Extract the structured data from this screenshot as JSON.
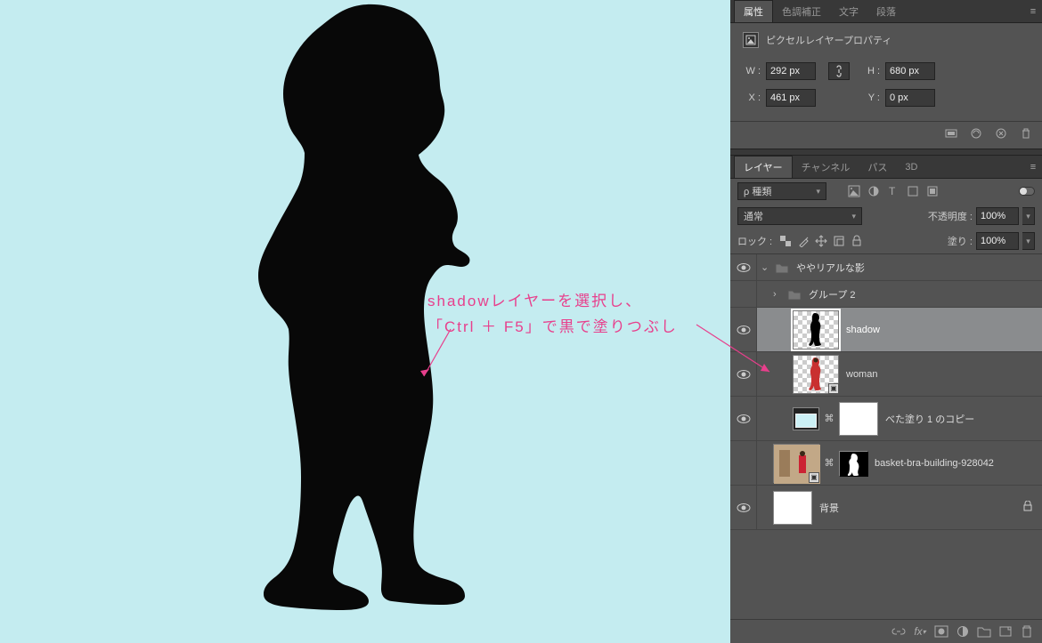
{
  "annotation": {
    "line1": "shadowレイヤーを選択し、",
    "line2": "「Ctrl ＋ F5」で黒で塗りつぶし"
  },
  "properties": {
    "tabs": [
      "属性",
      "色調補正",
      "文字",
      "段落"
    ],
    "title": "ピクセルレイヤープロパティ",
    "W_label": "W :",
    "W_value": "292 px",
    "H_label": "H :",
    "H_value": "680 px",
    "X_label": "X :",
    "X_value": "461 px",
    "Y_label": "Y :",
    "Y_value": "0 px"
  },
  "layers": {
    "tabs": [
      "レイヤー",
      "チャンネル",
      "パス",
      "3D"
    ],
    "filter_label": "種類",
    "blend_mode": "通常",
    "opacity_label": "不透明度 :",
    "opacity_value": "100%",
    "lock_label": "ロック :",
    "fill_label": "塗り :",
    "fill_value": "100%",
    "items": {
      "group1": "ややリアルな影",
      "group2": "グループ 2",
      "shadow": "shadow",
      "woman": "woman",
      "solid": "べた塗り 1 のコピー",
      "basket": "basket-bra-building-928042",
      "bg": "背景"
    }
  }
}
